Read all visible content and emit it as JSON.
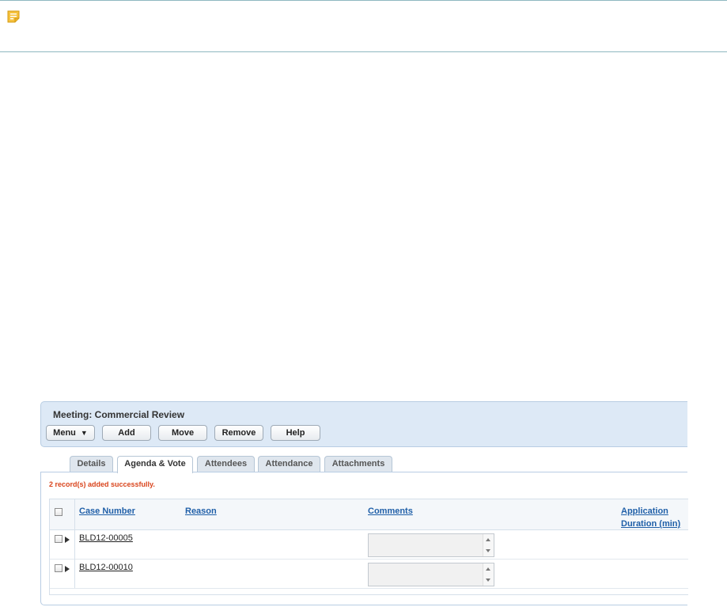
{
  "meeting": {
    "title": "Meeting: Commercial Review"
  },
  "toolbar": {
    "menu_label": "Menu",
    "add_label": "Add",
    "move_label": "Move",
    "remove_label": "Remove",
    "help_label": "Help"
  },
  "tabs": [
    {
      "label": "Details",
      "active": false
    },
    {
      "label": "Agenda & Vote",
      "active": true
    },
    {
      "label": "Attendees",
      "active": false
    },
    {
      "label": "Attendance",
      "active": false
    },
    {
      "label": "Attachments",
      "active": false
    }
  ],
  "message": "2 record(s) added successfully.",
  "table": {
    "columns": {
      "case_number": "Case Number",
      "reason": "Reason",
      "comments": "Comments",
      "duration_line1": "Application",
      "duration_line2": "Duration (min)"
    },
    "rows": [
      {
        "case_number": "BLD12-00005",
        "reason": "",
        "comments": "",
        "duration": ""
      },
      {
        "case_number": "BLD12-00010",
        "reason": "",
        "comments": "",
        "duration": ""
      }
    ]
  },
  "icons": {
    "note": "note-icon",
    "expander": "triangle-right-icon",
    "menu_caret": "chevron-down-icon"
  },
  "colors": {
    "note_icon": "#f2b705",
    "header_bg": "#dde9f6",
    "link": "#1f5fa8",
    "success": "#d9441c"
  }
}
